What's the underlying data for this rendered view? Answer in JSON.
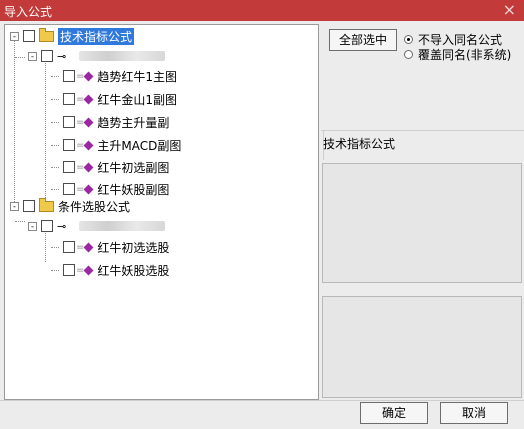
{
  "window": {
    "title": "导入公式",
    "close_symbol": "×"
  },
  "tree": {
    "indicator_group": {
      "expander": "-",
      "label": "技术指标公式",
      "subgroup_expander": "-",
      "items": [
        "趋势红牛1主图",
        "红牛金山1副图",
        "趋势主升量副",
        "主升MACD副图",
        "红牛初选副图",
        "红牛妖股副图"
      ]
    },
    "condition_group": {
      "expander": "-",
      "label": "条件选股公式",
      "subgroup_expander": "-",
      "items": [
        "红牛初选选股",
        "红牛妖股选股"
      ]
    }
  },
  "options": {
    "select_all_label": "全部选中",
    "radio_no_import_label": "不导入同名公式",
    "radio_overwrite_label": "覆盖同名(非系统)",
    "selected": "不导入同名公式"
  },
  "right_panel": {
    "section_title": "技术指标公式"
  },
  "footer": {
    "ok_label": "确定",
    "cancel_label": "取消"
  },
  "icons": {
    "folder": "folder-icon",
    "key": "key-icon",
    "diamond": "formula-diamond-icon"
  }
}
